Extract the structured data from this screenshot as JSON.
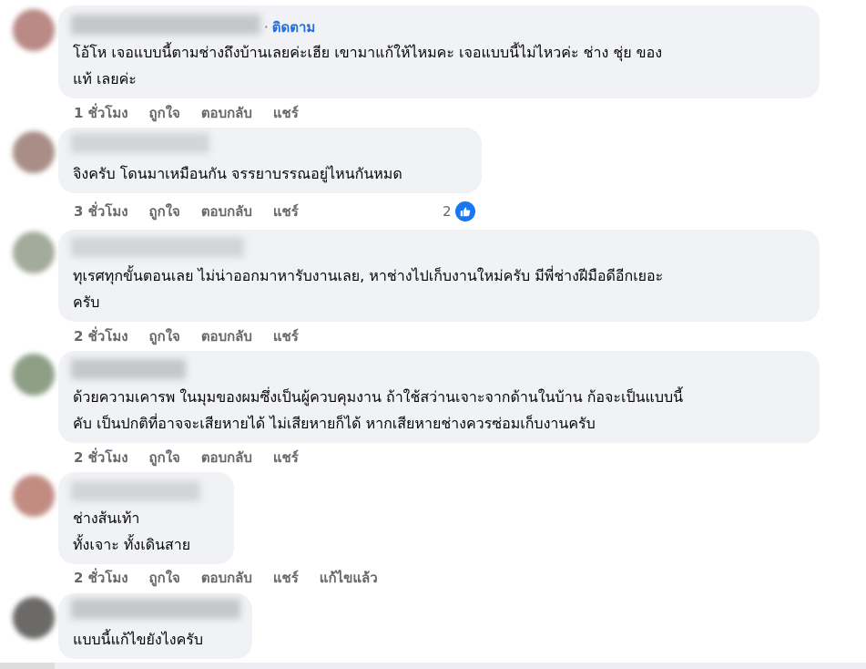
{
  "comments": [
    {
      "text": "โอ้โห เจอแบบนี้ตามช่างถึงบ้านเลยค่ะเฮีย เขามาแก้ให้ไหมคะ เจอแบบนี้ไม่ไหวค่ะ ช่าง ชุ่ย ของ\nแท้ เลยค่ะ",
      "follow_dot": "·",
      "follow": "ติดตาม",
      "time": "1 ชั่วโมง",
      "like": "ถูกใจ",
      "reply": "ตอบกลับ",
      "share": "แชร์",
      "avatar_color": "#b98a86"
    },
    {
      "text": "จิงครับ โดนมาเหมือนกัน จรรยาบรรณอยู่ไหนกันหมด",
      "time": "3 ชั่วโมง",
      "like": "ถูกใจ",
      "reply": "ตอบกลับ",
      "share": "แชร์",
      "reaction_count": "2",
      "avatar_color": "#a88e86"
    },
    {
      "text": "ทุเรศทุกขั้นตอนเลย ไม่น่าออกมาหารับงานเลย, หาช่างไปเก็บงานใหม่ครับ มีพี่ช่างฝีมือดีอีกเยอะ\nครับ",
      "time": "2 ชั่วโมง",
      "like": "ถูกใจ",
      "reply": "ตอบกลับ",
      "share": "แชร์",
      "avatar_color": "#a3ab9a"
    },
    {
      "text": "ด้วยความเคารพ ในมุมของผมซึ่งเป็นผู้ควบคุมงาน ถ้าใช้สว่านเจาะจากด้านในบ้าน ก้อจะเป็นแบบนี้\nคับ เป็นปกติที่อาจจะเสียหายได้ ไม่เสียหายก็ได้ หากเสียหายช่างควรซ่อมเก็บงานครับ",
      "time": "2 ชั่วโมง",
      "like": "ถูกใจ",
      "reply": "ตอบกลับ",
      "share": "แชร์",
      "avatar_color": "#8e9f86"
    },
    {
      "text": "ช่างส้นเท้า\nทั้งเจาะ ทั้งเดินสาย",
      "time": "2 ชั่วโมง",
      "like": "ถูกใจ",
      "reply": "ตอบกลับ",
      "share": "แชร์",
      "edited": "แก้ไขแล้ว",
      "avatar_color": "#c28c83"
    },
    {
      "text": "แบบนี้แก้ไขยังไงครับ",
      "avatar_color": "#6b6a68"
    }
  ]
}
